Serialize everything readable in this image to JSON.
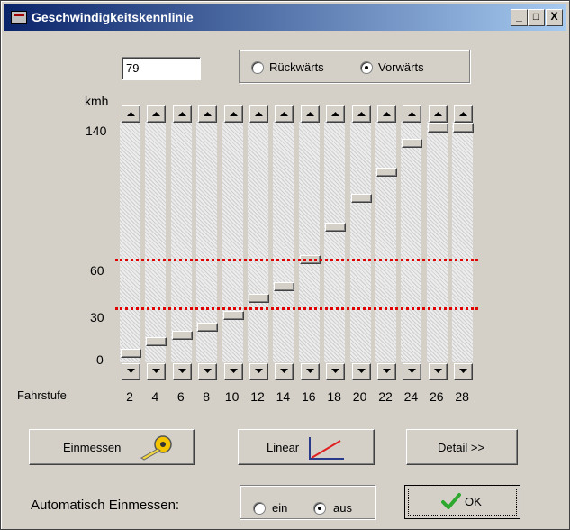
{
  "window": {
    "title": "Geschwindigkeitskennlinie"
  },
  "title_buttons": {
    "minimize": "_",
    "maximize": "□",
    "close": "X"
  },
  "value_input": {
    "value": "79"
  },
  "direction": {
    "options": [
      "Rückwärts",
      "Vorwärts"
    ],
    "selected": "Vorwärts"
  },
  "chart_data": {
    "type": "step-sliders",
    "y_unit_label": "kmh",
    "y_ticks": [
      "140",
      "60",
      "30",
      "0"
    ],
    "ylim": [
      0,
      140
    ],
    "reference_lines": [
      60,
      30
    ],
    "reference_line_color": "#e00000",
    "x_label": "Fahrstufe",
    "x_tick_labels": [
      "2",
      "4",
      "6",
      "8",
      "10",
      "12",
      "14",
      "16",
      "18",
      "20",
      "22",
      "24",
      "26",
      "28"
    ],
    "slider_values": [
      3,
      10,
      14,
      19,
      26,
      37,
      44,
      61,
      81,
      99,
      115,
      133,
      142,
      142
    ]
  },
  "buttons": {
    "einmessen": "Einmessen",
    "linear": "Linear",
    "detail": "Detail >>",
    "ok": "OK"
  },
  "auto_einmessen": {
    "label": "Automatisch Einmessen:",
    "options": [
      "ein",
      "aus"
    ],
    "selected": "aus"
  },
  "colors": {
    "title_bar_start": "#0a246a",
    "title_bar_end": "#a6caf0",
    "ok_check": "#2ea82e",
    "dialog_bg": "#d4d0c8"
  }
}
